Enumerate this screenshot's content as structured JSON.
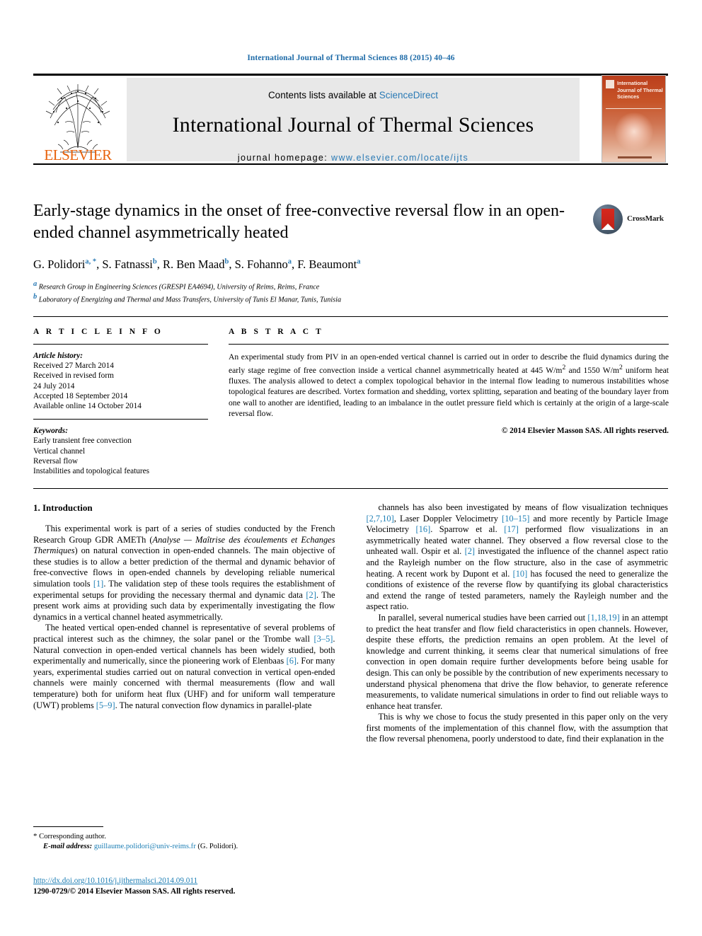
{
  "running_head": "International Journal of Thermal Sciences 88 (2015) 40–46",
  "masthead": {
    "contents_prefix": "Contents lists available at ",
    "sciencedirect": "ScienceDirect",
    "journal_title": "International Journal of Thermal Sciences",
    "homepage_prefix": "journal homepage: ",
    "homepage_url": "www.elsevier.com/locate/ijts",
    "publisher_wordmark": "ELSEVIER",
    "cover_title": "International Journal of Thermal Sciences",
    "accent_blue": "#2a7ab5",
    "elsevier_orange": "#E8620C"
  },
  "article": {
    "title": "Early-stage dynamics in the onset of free-convective reversal flow in an open-ended channel asymmetrically heated",
    "crossmark_label": "CrossMark",
    "authors": [
      {
        "name": "G. Polidori",
        "marks": "a, *"
      },
      {
        "name": "S. Fatnassi",
        "marks": "b"
      },
      {
        "name": "R. Ben Maad",
        "marks": "b"
      },
      {
        "name": "S. Fohanno",
        "marks": "a"
      },
      {
        "name": "F. Beaumont",
        "marks": "a"
      }
    ],
    "affiliations": [
      {
        "mark": "a",
        "text": "Research Group in Engineering Sciences (GRESPI EA4694), University of Reims, Reims, France"
      },
      {
        "mark": "b",
        "text": "Laboratory of Energizing and Thermal and Mass Transfers, University of Tunis El Manar, Tunis, Tunisia"
      }
    ]
  },
  "article_info": {
    "heading": "A R T I C L E  I N F O",
    "history_label": "Article history:",
    "history": [
      "Received 27 March 2014",
      "Received in revised form",
      "24 July 2014",
      "Accepted 18 September 2014",
      "Available online 14 October 2014"
    ],
    "keywords_label": "Keywords:",
    "keywords": [
      "Early transient free convection",
      "Vertical channel",
      "Reversal flow",
      "Instabilities and topological features"
    ]
  },
  "abstract": {
    "heading": "A B S T R A C T",
    "text": "An experimental study from PIV in an open-ended vertical channel is carried out in order to describe the fluid dynamics during the early stage regime of free convection inside a vertical channel asymmetrically heated at 445 W/m2 and 1550 W/m2 uniform heat fluxes. The analysis allowed to detect a complex topological behavior in the internal flow leading to numerous instabilities whose topological features are described. Vortex formation and shedding, vortex splitting, separation and beating of the boundary layer from one wall to another are identified, leading to an imbalance in the outlet pressure field which is certainly at the origin of a large-scale reversal flow.",
    "copyright": "© 2014 Elsevier Masson SAS. All rights reserved."
  },
  "body": {
    "section_heading": "1. Introduction",
    "left_paragraphs": [
      "This experimental work is part of a series of studies conducted by the French Research Group GDR AMETh (Analyse — Maîtrise des écoulements et Echanges Thermiques) on natural convection in open-ended channels. The main objective of these studies is to allow a better prediction of the thermal and dynamic behavior of free-convective flows in open-ended channels by developing reliable numerical simulation tools [1]. The validation step of these tools requires the establishment of experimental setups for providing the necessary thermal and dynamic data [2]. The present work aims at providing such data by experimentally investigating the flow dynamics in a vertical channel heated asymmetrically.",
      "The heated vertical open-ended channel is representative of several problems of practical interest such as the chimney, the solar panel or the Trombe wall [3–5]. Natural convection in open-ended vertical channels has been widely studied, both experimentally and numerically, since the pioneering work of Elenbaas [6]. For many years, experimental studies carried out on natural convection in vertical open-ended channels were mainly concerned with thermal measurements (flow and wall temperature) both for uniform heat flux (UHF) and for uniform wall temperature (UWT) problems [5–9]. The natural convection flow dynamics in parallel-plate"
    ],
    "right_paragraphs": [
      "channels has also been investigated by means of flow visualization techniques [2,7,10], Laser Doppler Velocimetry [10–15] and more recently by Particle Image Velocimetry [16]. Sparrow et al. [17] performed flow visualizations in an asymmetrically heated water channel. They observed a flow reversal close to the unheated wall. Ospir et al. [2] investigated the influence of the channel aspect ratio and the Rayleigh number on the flow structure, also in the case of asymmetric heating. A recent work by Dupont et al. [10] has focused the need to generalize the conditions of existence of the reverse flow by quantifying its global characteristics and extend the range of tested parameters, namely the Rayleigh number and the aspect ratio.",
      "In parallel, several numerical studies have been carried out [1,18,19] in an attempt to predict the heat transfer and flow field characteristics in open channels. However, despite these efforts, the prediction remains an open problem. At the level of knowledge and current thinking, it seems clear that numerical simulations of free convection in open domain require further developments before being usable for design. This can only be possible by the contribution of new experiments necessary to understand physical phenomena that drive the flow behavior, to generate reference measurements, to validate numerical simulations in order to find out reliable ways to enhance heat transfer.",
      "This is why we chose to focus the study presented in this paper only on the very first moments of the implementation of this channel flow, with the assumption that the flow reversal phenomena, poorly understood to date, find their explanation in the"
    ]
  },
  "footer": {
    "corresponding_author": "Corresponding author.",
    "email_label": "E-mail address:",
    "email": "guillaume.polidori@univ-reims.fr",
    "email_suffix": "(G. Polidori).",
    "doi": "http://dx.doi.org/10.1016/j.ijthermalsci.2014.09.011",
    "issn_line": "1290-0729/© 2014 Elsevier Masson SAS. All rights reserved."
  }
}
